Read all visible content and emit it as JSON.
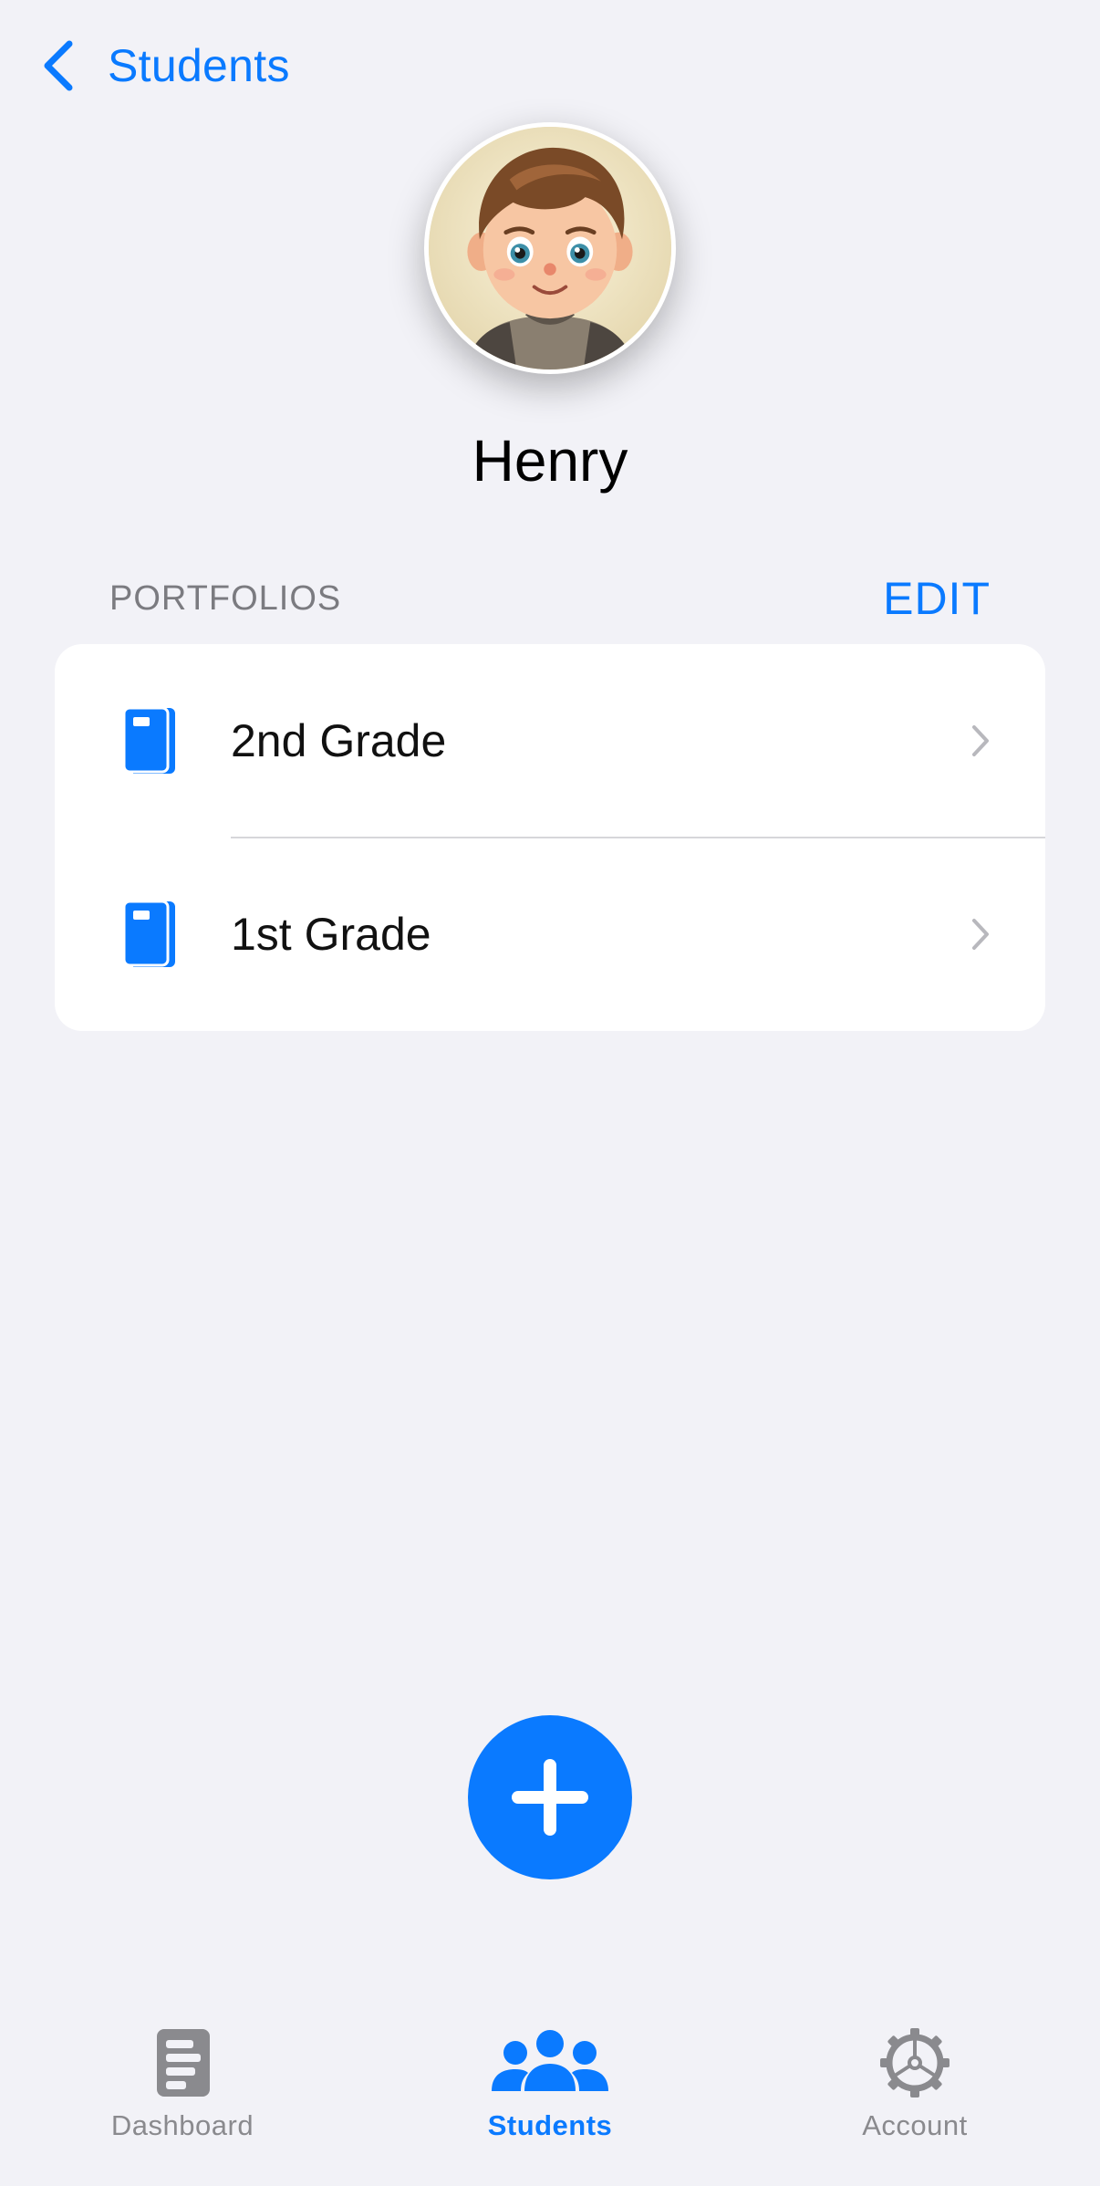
{
  "nav": {
    "back_label": "Students",
    "back_icon": "chevron-left-icon"
  },
  "student": {
    "name": "Henry",
    "avatar_icon": "student-avatar"
  },
  "portfolios": {
    "header": "PORTFOLIOS",
    "edit_label": "EDIT",
    "items": [
      {
        "label": "2nd Grade",
        "icon": "book-icon"
      },
      {
        "label": "1st Grade",
        "icon": "book-icon"
      }
    ]
  },
  "fab": {
    "icon": "plus-icon"
  },
  "tabbar": {
    "tabs": [
      {
        "label": "Dashboard",
        "icon": "dashboard-icon",
        "active": false
      },
      {
        "label": "Students",
        "icon": "people-icon",
        "active": true
      },
      {
        "label": "Account",
        "icon": "gear-icon",
        "active": false
      }
    ]
  },
  "colors": {
    "accent": "#0a7aff",
    "background": "#f2f2f7",
    "secondary_text": "#8a8a8e"
  }
}
